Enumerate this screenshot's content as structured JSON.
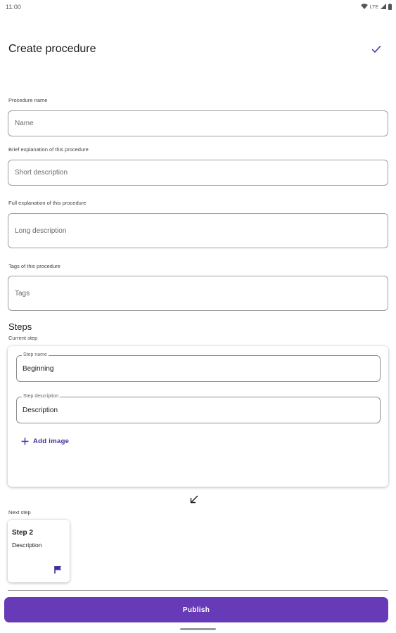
{
  "status_bar": {
    "time": "11:00",
    "network": "LTE"
  },
  "app_bar": {
    "title": "Create procedure",
    "confirm_icon": "check-icon"
  },
  "form": {
    "name": {
      "label": "Procedure name",
      "placeholder": "Name"
    },
    "short_description": {
      "label": "Brief explanation of this procedure",
      "placeholder": "Short description"
    },
    "long_description": {
      "label": "Full explanation of this procedure",
      "placeholder": "Long description"
    },
    "tags": {
      "label": "Tags of this procedure",
      "placeholder": "Tags"
    }
  },
  "steps": {
    "title": "Steps",
    "current_label": "Current step",
    "current_step": {
      "name_label": "Step name",
      "name_value": "Beginning",
      "description_label": "Step description",
      "description_value": "Description",
      "add_image_label": "Add image"
    },
    "next_label": "Next step",
    "next_step": {
      "title": "Step 2",
      "description": "Description",
      "icon": "flag-icon"
    }
  },
  "publish_label": "Publish",
  "colors": {
    "accent": "#673ab7",
    "accent_text": "#3c2f9a",
    "outline": "#9e9e9e"
  }
}
